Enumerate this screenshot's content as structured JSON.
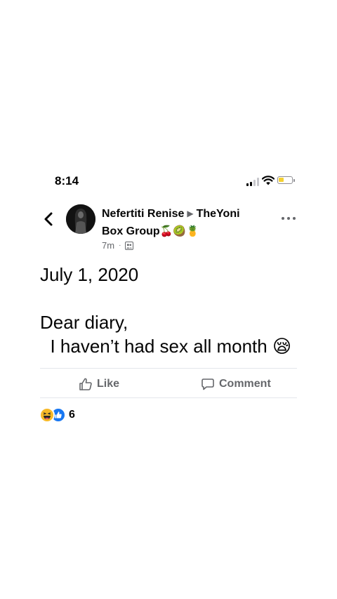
{
  "status_bar": {
    "time": "8:14"
  },
  "post": {
    "author": "Nefertiti Renise",
    "group_line_1": "TheYoni",
    "group_line_2": "Box Group",
    "group_emojis": "🍒🥝🍍",
    "timestamp": "7m",
    "separator": "·",
    "privacy_icon": "group-members-icon",
    "body": {
      "line1": "July 1, 2020",
      "line2": "Dear diary,",
      "line3": "  I haven’t had sex all month",
      "emoji": "😪"
    }
  },
  "actions": {
    "like_label": "Like",
    "comment_label": "Comment"
  },
  "reactions": {
    "count": "6",
    "types": [
      "haha",
      "like"
    ]
  },
  "colors": {
    "text_primary": "#050505",
    "text_secondary": "#65676b",
    "divider": "#e4e6eb",
    "like_blue": "#1877f2",
    "haha_yellow": "#f7b928",
    "battery_low": "#f5d132"
  }
}
